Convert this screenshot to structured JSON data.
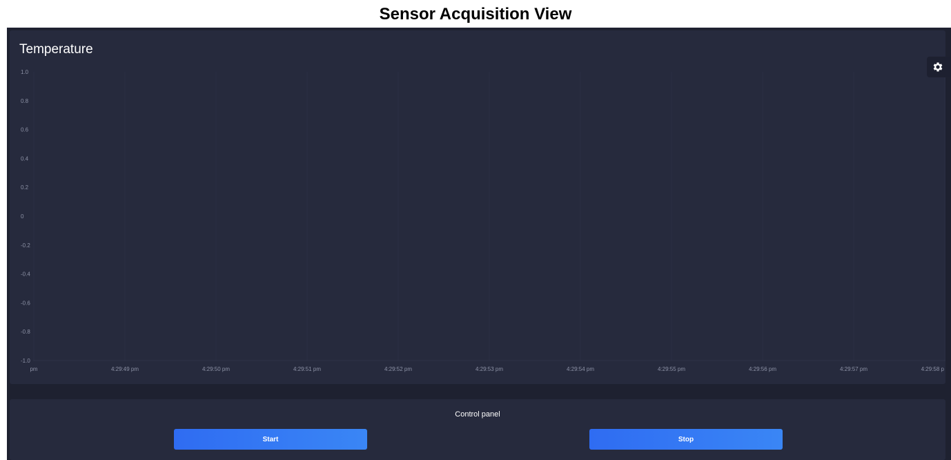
{
  "page": {
    "title": "Sensor Acquisition View"
  },
  "chart_panel": {
    "title": "Temperature",
    "settings_icon": "gear-icon"
  },
  "chart_data": {
    "type": "line",
    "title": "Temperature",
    "xlabel": "",
    "ylabel": "",
    "ylim": [
      -1.0,
      1.0
    ],
    "y_ticks": [
      "1.0",
      "0.8",
      "0.6",
      "0.4",
      "0.2",
      "0",
      "-0.2",
      "-0.4",
      "-0.6",
      "-0.8",
      "-1.0"
    ],
    "x_ticks": [
      "pm",
      "4:29:49 pm",
      "4:29:50 pm",
      "4:29:51 pm",
      "4:29:52 pm",
      "4:29:53 pm",
      "4:29:54 pm",
      "4:29:55 pm",
      "4:29:56 pm",
      "4:29:57 pm",
      "4:29:58 p"
    ],
    "series": [],
    "grid": true
  },
  "control_panel": {
    "title": "Control panel",
    "start_label": "Start",
    "stop_label": "Stop"
  },
  "colors": {
    "page_bg": "#ffffff",
    "app_bg": "#1e2130",
    "panel_bg": "#262a3d",
    "button_accent": "#2f6cf2",
    "tick_text": "#8d92a6"
  }
}
